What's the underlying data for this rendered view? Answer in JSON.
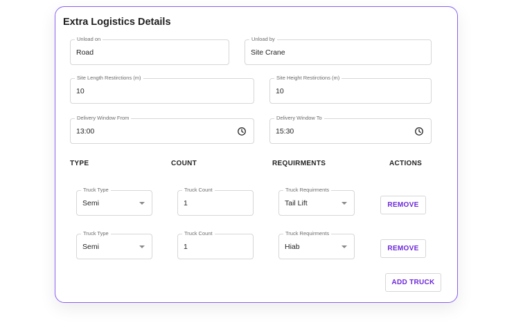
{
  "title": "Extra Logistics Details",
  "fields": {
    "unload_on": {
      "label": "Unload on",
      "value": "Road"
    },
    "unload_by": {
      "label": "Unload by",
      "value": "Site Crane"
    },
    "site_length": {
      "label": "Site Length Restirctions (m)",
      "value": "10"
    },
    "site_height": {
      "label": "Site Height Restirctions (m)",
      "value": "10"
    },
    "window_from": {
      "label": "Delivery Window From",
      "value": "13:00"
    },
    "window_to": {
      "label": "Delivery Window To",
      "value": "15:30"
    }
  },
  "table": {
    "headers": {
      "type": "TYPE",
      "count": "COUNT",
      "requirements": "REQUIRMENTS",
      "actions": "ACTIONS"
    },
    "rows": [
      {
        "type_label": "Truck Type",
        "type_value": "Semi",
        "count_label": "Truck Count",
        "count_value": "1",
        "req_label": "Truck Requirments",
        "req_value": "Tail Lift",
        "action": "REMOVE"
      },
      {
        "type_label": "Truck Type",
        "type_value": "Semi",
        "count_label": "Truck Count",
        "count_value": "1",
        "req_label": "Truck Requirments",
        "req_value": "Hiab",
        "action": "REMOVE"
      }
    ]
  },
  "add_truck_label": "ADD TRUCK",
  "colors": {
    "accent": "#8a5cf0",
    "button_text": "#6d28d9",
    "border": "#d6d6d6"
  },
  "icons": {
    "time": "clock-icon",
    "dropdown": "chevron-down-icon"
  }
}
